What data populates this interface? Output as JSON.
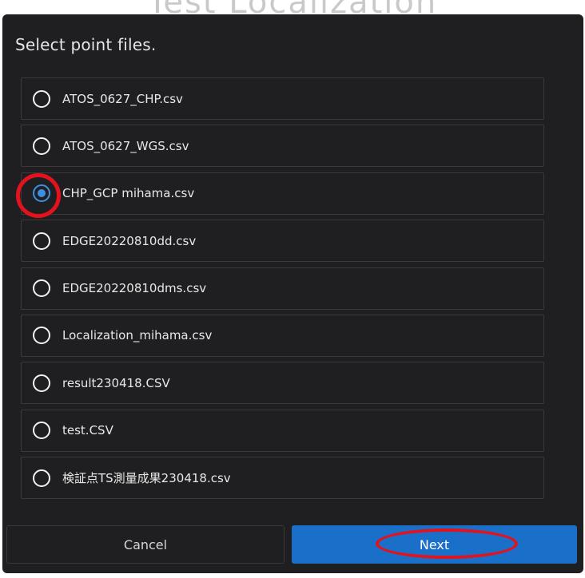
{
  "background_title": "Test Localization",
  "dialog": {
    "title": "Select point files."
  },
  "files": [
    {
      "label": "ATOS_0627_CHP.csv",
      "selected": false
    },
    {
      "label": "ATOS_0627_WGS.csv",
      "selected": false
    },
    {
      "label": "CHP_GCP mihama.csv",
      "selected": true
    },
    {
      "label": "EDGE20220810dd.csv",
      "selected": false
    },
    {
      "label": "EDGE20220810dms.csv",
      "selected": false
    },
    {
      "label": "Localization_mihama.csv",
      "selected": false
    },
    {
      "label": "result230418.CSV",
      "selected": false
    },
    {
      "label": "test.CSV",
      "selected": false
    },
    {
      "label": "検証点TS測量成果230418.csv",
      "selected": false
    }
  ],
  "buttons": {
    "cancel": "Cancel",
    "next": "Next"
  },
  "colors": {
    "dialog_bg": "#1f1f21",
    "accent": "#1a6fc9",
    "radio_checked": "#3d8fe0",
    "annotation": "#e3121d"
  }
}
